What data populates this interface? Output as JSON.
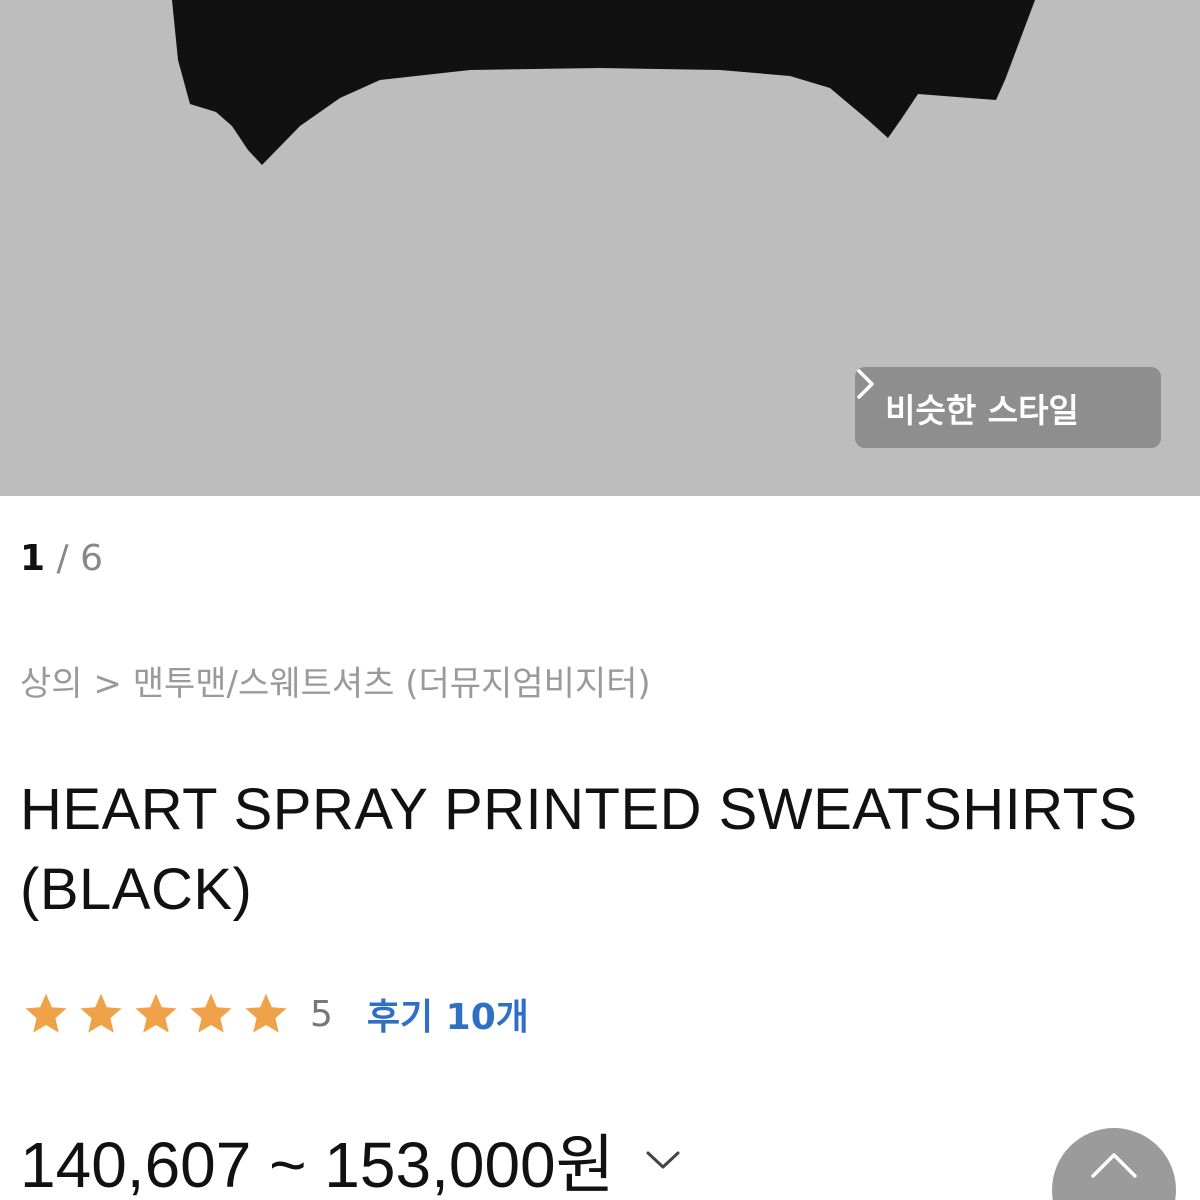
{
  "gallery": {
    "similar_style_label": "비슷한 스타일",
    "pager": {
      "current": "1",
      "separator": "/",
      "total": "6"
    }
  },
  "breadcrumb": {
    "category": "상의",
    "separator": ">",
    "subcategory": "맨투맨/스웨트셔츠",
    "brand": "(더뮤지엄비지터)"
  },
  "product": {
    "title": "HEART SPRAY PRINTED SWEATSHIRTS (BLACK)",
    "rating": {
      "value": "5",
      "stars_filled": 5,
      "stars_total": 5,
      "review_label": "후기 10개"
    },
    "price_range": "140,607 ~ 153,000원"
  },
  "colors": {
    "image_background": "#bdbdbd",
    "garment": "#111111",
    "star": "#f0a248",
    "review_link": "#2f6fc4",
    "muted_text": "#9a9a9a"
  },
  "icons": {
    "similar_chevron": "chevron-right-icon",
    "price_toggle": "chevron-down-icon",
    "scroll_top": "chevron-up-icon",
    "star": "star-icon"
  }
}
